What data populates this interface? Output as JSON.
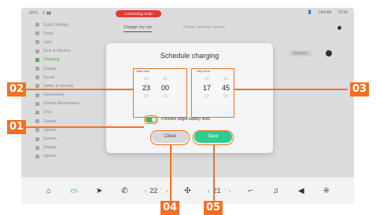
{
  "status_bar": {
    "temp": "20°C",
    "notice": "Connecting mode",
    "user": "Lbhngh",
    "time": "12:56"
  },
  "sidebar": {
    "items": [
      {
        "label": "Quick Settings"
      },
      {
        "label": "Pedal"
      },
      {
        "label": "Light"
      },
      {
        "label": "Door & Window"
      },
      {
        "label": "Charging",
        "active": true
      },
      {
        "label": "Display"
      },
      {
        "label": "Sound"
      },
      {
        "label": "Safety & Security"
      },
      {
        "label": "Connectivity"
      },
      {
        "label": "Vehicle Maintenance"
      },
      {
        "label": "Seat"
      },
      {
        "label": "Display"
      },
      {
        "label": "Update"
      },
      {
        "label": "System"
      },
      {
        "label": "Display"
      },
      {
        "label": "Update"
      }
    ]
  },
  "main": {
    "tab_charge": "Charge my car",
    "tab_power": "Power another device",
    "toggle_text": "Dynamic"
  },
  "modal": {
    "title": "Schedule charging",
    "start_label": "Start time",
    "stop_label": "Stop time",
    "start_hours": [
      "22",
      "23",
      "00"
    ],
    "start_minutes": [
      "45",
      "00",
      "15"
    ],
    "stop_hours": [
      "16",
      "17",
      "18"
    ],
    "stop_minutes": [
      "30",
      "45",
      "00"
    ],
    "prioritize_label": "Prioritize target battery level",
    "close_label": "Close",
    "save_label": "Save"
  },
  "dock": {
    "temp_left": "22",
    "temp_right": "21"
  },
  "callouts": [
    "01",
    "02",
    "03",
    "04",
    "05"
  ],
  "colors": {
    "accent": "#f37021",
    "save": "#2ecc8f",
    "toggle_on": "#4caf50"
  }
}
